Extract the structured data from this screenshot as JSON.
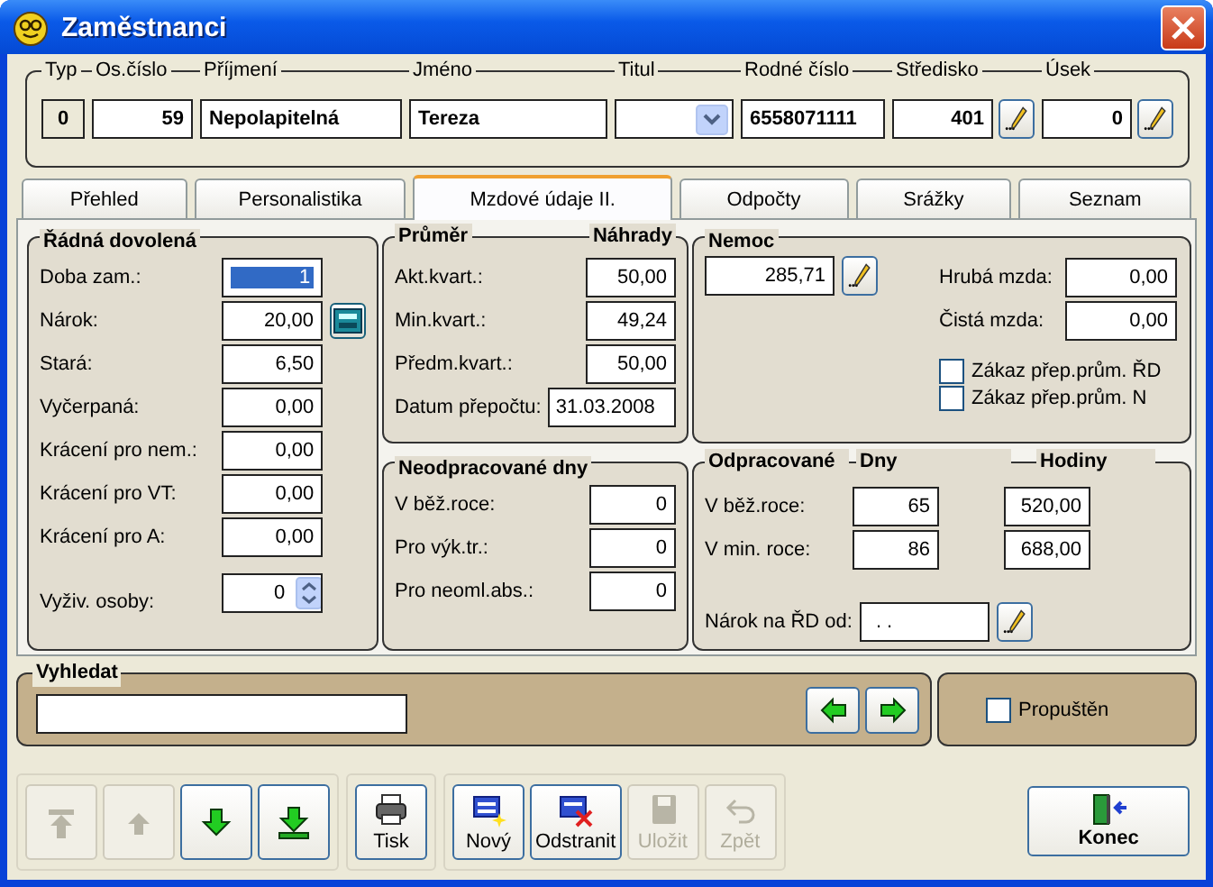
{
  "window": {
    "title": "Zaměstnanci"
  },
  "header": {
    "fields": [
      {
        "label": "Typ",
        "value": "0",
        "kind": "readonly"
      },
      {
        "label": "Os.číslo",
        "value": "59",
        "kind": "number"
      },
      {
        "label": "Příjmení",
        "value": "Nepolapitelná",
        "kind": "text"
      },
      {
        "label": "Jméno",
        "value": "Tereza",
        "kind": "text"
      },
      {
        "label": "Titul",
        "kind": "combo"
      },
      {
        "label": "Rodné číslo",
        "value": "6558071111",
        "kind": "text"
      },
      {
        "label": "Středisko",
        "value": "401",
        "kind": "lookup"
      },
      {
        "label": "Úsek",
        "value": "0",
        "kind": "lookup"
      }
    ]
  },
  "tabs": [
    {
      "label": "Přehled",
      "selected": false
    },
    {
      "label": "Personalistika",
      "selected": false
    },
    {
      "label": "Mzdové údaje II.",
      "selected": true
    },
    {
      "label": "Odpočty",
      "selected": false
    },
    {
      "label": "Srážky",
      "selected": false
    },
    {
      "label": "Seznam",
      "selected": false
    }
  ],
  "vacation": {
    "title": "Řádná dovolená",
    "fields": [
      {
        "label": "Doba zam.:",
        "value": "1",
        "kind": "plain",
        "focused": true
      },
      {
        "label": "Nárok:",
        "value": "20,00",
        "kind": "calc",
        "focused": false
      },
      {
        "label": "Stará:",
        "value": "6,50",
        "kind": "plain",
        "focused": false
      },
      {
        "label": "Vyčerpaná:",
        "value": "0,00",
        "kind": "plain",
        "focused": false
      },
      {
        "label": "Krácení pro nem.:",
        "value": "0,00",
        "kind": "plain",
        "focused": false
      },
      {
        "label": "Krácení pro VT:",
        "value": "0,00",
        "kind": "plain",
        "focused": false
      },
      {
        "label": "Krácení pro A:",
        "value": "0,00",
        "kind": "plain",
        "focused": false
      },
      {
        "label": "Vyživ. osoby:",
        "value": "0",
        "kind": "spin",
        "focused": false
      }
    ]
  },
  "average": {
    "title": "Průměr",
    "column": "Náhrady",
    "fields": [
      {
        "label": "Akt.kvart.:",
        "value": "50,00"
      },
      {
        "label": "Min.kvart.:",
        "value": "49,24"
      },
      {
        "label": "Předm.kvart.:",
        "value": "50,00"
      },
      {
        "label": "Datum přepočtu:",
        "value": "31.03.2008"
      }
    ]
  },
  "sickness": {
    "title": "Nemoc",
    "value": "285,71",
    "fields": [
      {
        "label": "Hrubá mzda:",
        "value": "0,00"
      },
      {
        "label": "Čistá mzda:",
        "value": "0,00"
      }
    ],
    "checkboxes": [
      {
        "label": "Zákaz přep.prům. ŘD",
        "checked": false
      },
      {
        "label": "Zákaz přep.prům. N",
        "checked": false
      }
    ]
  },
  "unworked": {
    "title": "Neodpracované dny",
    "fields": [
      {
        "label": "V běž.roce:",
        "value": "0"
      },
      {
        "label": "Pro výk.tr.:",
        "value": "0"
      },
      {
        "label": "Pro neoml.abs.:",
        "value": "0"
      }
    ]
  },
  "worked": {
    "title": "Odpracované",
    "columns": [
      "Dny",
      "Hodiny"
    ],
    "rows": [
      {
        "label": "V běž.roce:",
        "days": "65",
        "hours": "520,00"
      },
      {
        "label": "V min. roce:",
        "days": "86",
        "hours": "688,00"
      }
    ],
    "entitlement": {
      "label": "Nárok na ŘD od:",
      "value": ". ."
    }
  },
  "search": {
    "title": "Vyhledat",
    "buttons": [
      {
        "kind": "left"
      },
      {
        "kind": "right"
      }
    ]
  },
  "released": {
    "label": "Propuštěn",
    "checked": false
  },
  "toolbar": {
    "groups": [
      [
        {
          "kind": "first",
          "disabled": true
        },
        {
          "kind": "prev",
          "disabled": true
        },
        {
          "kind": "next",
          "disabled": false
        },
        {
          "kind": "last",
          "disabled": false
        }
      ],
      [
        {
          "kind": "print",
          "label": "Tisk",
          "disabled": false
        }
      ],
      [
        {
          "kind": "new",
          "label": "Nový",
          "disabled": false
        },
        {
          "kind": "delete",
          "label": "Odstranit",
          "disabled": false
        },
        {
          "kind": "save",
          "label": "Uložit",
          "disabled": true
        },
        {
          "kind": "undo",
          "label": "Zpět",
          "disabled": true
        }
      ]
    ]
  },
  "exit_button": {
    "label": "Konec"
  }
}
